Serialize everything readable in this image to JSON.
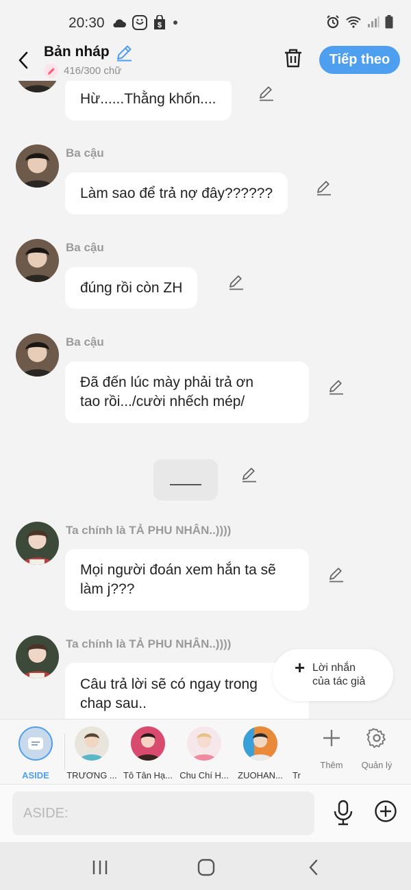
{
  "status_bar": {
    "time": "20:30"
  },
  "header": {
    "title": "Bản nháp",
    "word_count": "416/300 chữ",
    "next_label": "Tiếp theo"
  },
  "messages": [
    {
      "sender": "",
      "text": "Hừ......Thằng khốn...."
    },
    {
      "sender": "Ba cậu",
      "text": "Làm sao để trả nợ đây??????"
    },
    {
      "sender": "Ba cậu",
      "text": "đúng rồi còn ZH"
    },
    {
      "sender": "Ba cậu",
      "text": "Đã đến lúc mày phải trả ơn\ntao rồi.../cười nhếch mép/"
    },
    {
      "sender": "Ta chính là TẢ PHU NHÂN..))))",
      "text": "Mọi người đoán xem hắn ta sẽ\nlàm j???"
    },
    {
      "sender": "Ta chính là TẢ PHU NHÂN..))))",
      "text": "Câu trả lời sẽ có ngay trong\nchap sau.."
    }
  ],
  "author_note": {
    "label": "Lời nhắn\ncủa tác giả"
  },
  "characters": [
    {
      "name": "ASIDE"
    },
    {
      "name": "TRƯƠNG ..."
    },
    {
      "name": "Tô Tân Hạ..."
    },
    {
      "name": "Chu Chí H..."
    },
    {
      "name": "ZUOHAN..."
    },
    {
      "name": "Tr"
    }
  ],
  "tools": {
    "add_label": "Thêm",
    "manage_label": "Quản lý"
  },
  "input": {
    "placeholder": "ASIDE:"
  },
  "colors": {
    "accent": "#4e9ff0",
    "background": "#f3f3f3"
  }
}
